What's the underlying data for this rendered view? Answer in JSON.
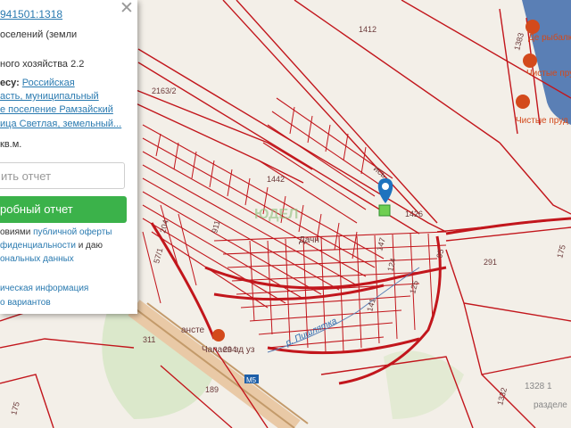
{
  "colors": {
    "parcel": "#c2161c",
    "parcel_label": "#6b3a3a",
    "green": "#3bb24a",
    "link": "#2a7ab0",
    "water": "#5a7fb5",
    "poi": "#d34a1c"
  },
  "panel": {
    "close_icon": "close-icon",
    "cadastral_number": "941501:1318",
    "category_line": "оселений (земли",
    "usage_line": "ного хозяйства 2.2",
    "address_label": "есу:",
    "address_lines": [
      "Российская",
      "асть, муниципальный",
      "е поселение Рамзайский",
      "ица Светлая, земельный..."
    ],
    "area": "кв.м.",
    "input_placeholder": "ить отчет",
    "button_label": "робный отчет",
    "consent_line1_pre": "овиями",
    "consent_line1_link": "публичной оферты",
    "consent_line2_link": "фиденциальности",
    "consent_line2_post": "и даю",
    "consent_line3_link": "ональных данных",
    "link_info": "ическая информация",
    "link_variants": "о вариантов"
  },
  "map": {
    "parcel_labels": [
      "1412",
      "2163/2",
      "1442",
      "1426",
      "911",
      "204",
      "57/1",
      "147",
      "124",
      "125",
      "141",
      "95",
      "175",
      "291",
      "1332",
      "1383",
      "311",
      "189",
      "175",
      "294"
    ],
    "place_labels": {
      "chistye_prudy_1": "Чистые пруды",
      "chistye_prudy_2": "Чистые пруд",
      "rybalka": "Де рыбалк",
      "village": "Дачн",
      "river": "р. Пишлятка",
      "road_sign": "М5",
      "crossing": "Чапаев  зд  уз",
      "street": "ись",
      "station": "ансте",
      "razdel": "разделе",
      "tucki": "1328 1",
      "watermark": "ЮДЕЛ"
    },
    "marker_icon": "map-pin-icon"
  }
}
